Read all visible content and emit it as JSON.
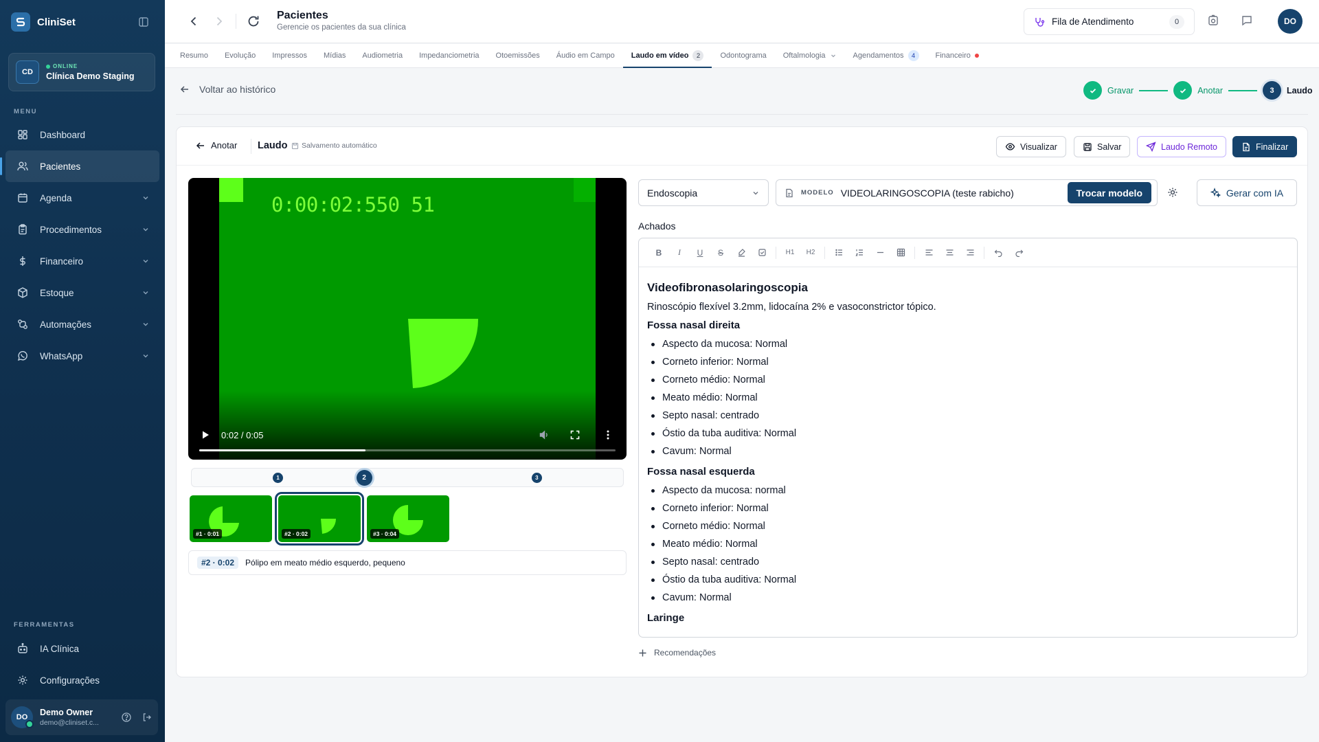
{
  "app": {
    "name": "CliniSet"
  },
  "clinic": {
    "status": "ONLINE",
    "name": "Clínica Demo Staging",
    "initials": "CD"
  },
  "sidebar": {
    "menu_label": "MENU",
    "items": [
      {
        "label": "Dashboard"
      },
      {
        "label": "Pacientes"
      },
      {
        "label": "Agenda"
      },
      {
        "label": "Procedimentos"
      },
      {
        "label": "Financeiro"
      },
      {
        "label": "Estoque"
      },
      {
        "label": "Automações"
      },
      {
        "label": "WhatsApp"
      }
    ],
    "tools_label": "FERRAMENTAS",
    "tools": [
      {
        "label": "IA Clínica"
      },
      {
        "label": "Configurações"
      }
    ]
  },
  "user": {
    "name": "Demo Owner",
    "email": "demo@cliniset.c...",
    "initials": "DO"
  },
  "header": {
    "title": "Pacientes",
    "subtitle": "Gerencie os pacientes da sua clínica",
    "queue_label": "Fila de Atendimento",
    "queue_count": "0",
    "avatar": "DO"
  },
  "tabs": [
    {
      "label": "Resumo"
    },
    {
      "label": "Evolução"
    },
    {
      "label": "Impressos"
    },
    {
      "label": "Mídias"
    },
    {
      "label": "Audiometria"
    },
    {
      "label": "Impedanciometria"
    },
    {
      "label": "Otoemissões"
    },
    {
      "label": "Áudio em Campo"
    },
    {
      "label": "Laudo em vídeo",
      "badge": "2"
    },
    {
      "label": "Odontograma"
    },
    {
      "label": "Oftalmologia"
    },
    {
      "label": "Agendamentos",
      "badge": "4"
    },
    {
      "label": "Financeiro"
    }
  ],
  "back": {
    "label": "Voltar ao histórico"
  },
  "stepper": {
    "steps": [
      {
        "label": "Gravar",
        "state": "done"
      },
      {
        "label": "Anotar",
        "state": "done"
      },
      {
        "label": "Laudo",
        "state": "current",
        "number": "3"
      }
    ]
  },
  "card": {
    "back_label": "Anotar",
    "title": "Laudo",
    "autosave": "Salvamento automático",
    "buttons": {
      "preview": "Visualizar",
      "save": "Salvar",
      "remote": "Laudo Remoto",
      "finish": "Finalizar"
    }
  },
  "video": {
    "overlay_time": "0:00:02:550 51",
    "time": "0:02 / 0:05",
    "progress": 0.4
  },
  "timeline": {
    "markers": [
      {
        "number": "1",
        "pos": 0.2
      },
      {
        "number": "2",
        "pos": 0.4,
        "selected": true
      },
      {
        "number": "3",
        "pos": 0.8
      }
    ]
  },
  "thumbnails": [
    {
      "label": "#1 · 0:01"
    },
    {
      "label": "#2 · 0:02",
      "selected": true
    },
    {
      "label": "#3 · 0:04"
    }
  ],
  "annotation": {
    "tag": "#2 · 0:02",
    "text": "Pólipo em meato médio esquerdo, pequeno"
  },
  "editor_panel": {
    "specialty": "Endoscopia",
    "model_tag": "MODELO",
    "model_name": "VIDEOLARINGOSCOPIA (teste rabicho)",
    "change_model": "Trocar modelo",
    "ai_button": "Gerar com IA",
    "findings_label": "Achados",
    "toolbar": {
      "h1": "H1",
      "h2": "H2"
    },
    "recommendations": "Recomendações"
  },
  "document": {
    "title": "Videofibronasolaringoscopia",
    "intro": "Rinoscópio flexível 3.2mm, lidocaína 2% e vasoconstrictor tópico.",
    "sections": [
      {
        "heading": "Fossa nasal direita",
        "items": [
          "Aspecto da mucosa: Normal",
          "Corneto inferior: Normal",
          "Corneto médio: Normal",
          "Meato médio: Normal",
          "Septo nasal: centrado",
          "Óstio da tuba auditiva: Normal",
          "Cavum: Normal"
        ]
      },
      {
        "heading": "Fossa nasal esquerda",
        "items": [
          "Aspecto da mucosa: normal",
          "Corneto inferior: Normal",
          "Corneto médio: Normal",
          "Meato médio: Normal",
          "Septo nasal: centrado",
          "Óstio da tuba auditiva: Normal",
          "Cavum: Normal"
        ]
      },
      {
        "heading": "Laringe",
        "items": []
      }
    ]
  },
  "colors": {
    "primary": "#16436c",
    "success": "#10b981",
    "sidebar": "#13395a",
    "video_green": "#009a00",
    "highlight_green": "#5dff1a"
  }
}
